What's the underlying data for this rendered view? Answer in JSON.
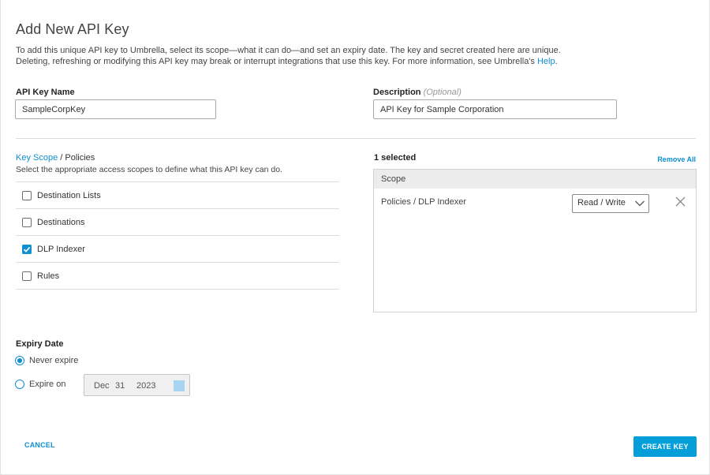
{
  "page": {
    "title": "Add New API Key",
    "intro_line1": "To add this unique API key to Umbrella, select its scope—what it can do—and set an expiry date. The key and secret created here are unique.",
    "intro_line2": "Deleting, refreshing or modifying this API key may break or interrupt integrations that use this key. For more information, see Umbrella's ",
    "help_link": "Help",
    "help_suffix": "."
  },
  "form": {
    "name_label": "API Key Name",
    "name_value": "SampleCorpKey",
    "description_label": "Description",
    "description_optional": "(Optional)",
    "description_value": "API Key for Sample Corporation"
  },
  "scope": {
    "heading_link": "Key Scope",
    "heading_rest": " / Policies",
    "description": "Select the appropriate access scopes to define what this API key can do.",
    "items": [
      {
        "label": "Destination Lists",
        "checked": false
      },
      {
        "label": "Destinations",
        "checked": false
      },
      {
        "label": "DLP Indexer",
        "checked": true
      },
      {
        "label": "Rules",
        "checked": false
      }
    ]
  },
  "selected": {
    "count_label": "1 selected",
    "remove_all": "Remove All",
    "column_header": "Scope",
    "rows": [
      {
        "label": "Policies / DLP Indexer",
        "access": "Read / Write"
      }
    ]
  },
  "expiry": {
    "label": "Expiry Date",
    "never_label": "Never expire",
    "expire_on_label": "Expire on",
    "selected": "never",
    "month": "Dec",
    "day": "31",
    "year": "2023"
  },
  "actions": {
    "cancel": "CANCEL",
    "create": "CREATE KEY"
  },
  "colors": {
    "accent": "#049fd9",
    "link": "#0d8fd1"
  }
}
